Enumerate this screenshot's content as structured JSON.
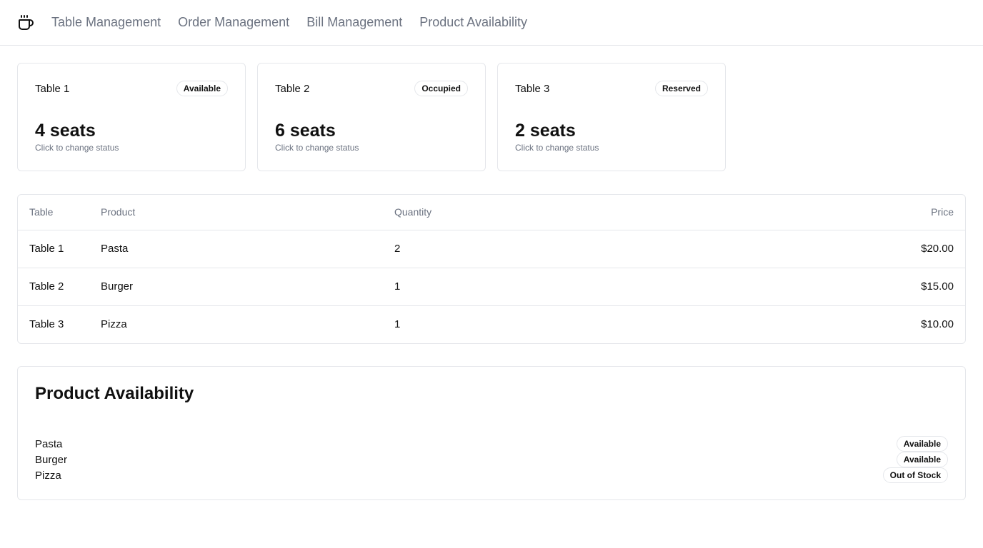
{
  "header": {
    "logo_icon": "coffee-cup-icon",
    "nav": [
      {
        "label": "Table Management"
      },
      {
        "label": "Order Management"
      },
      {
        "label": "Bill Management"
      },
      {
        "label": "Product Availability"
      }
    ]
  },
  "tables": [
    {
      "name": "Table 1",
      "status": "Available",
      "seats": "4 seats",
      "hint": "Click to change status"
    },
    {
      "name": "Table 2",
      "status": "Occupied",
      "seats": "6 seats",
      "hint": "Click to change status"
    },
    {
      "name": "Table 3",
      "status": "Reserved",
      "seats": "2 seats",
      "hint": "Click to change status"
    }
  ],
  "orders": {
    "headers": {
      "table": "Table",
      "product": "Product",
      "quantity": "Quantity",
      "price": "Price"
    },
    "rows": [
      {
        "table": "Table 1",
        "product": "Pasta",
        "quantity": "2",
        "price": "$20.00"
      },
      {
        "table": "Table 2",
        "product": "Burger",
        "quantity": "1",
        "price": "$15.00"
      },
      {
        "table": "Table 3",
        "product": "Pizza",
        "quantity": "1",
        "price": "$10.00"
      }
    ]
  },
  "availability": {
    "title": "Product Availability",
    "items": [
      {
        "name": "Pasta",
        "status": "Available"
      },
      {
        "name": "Burger",
        "status": "Available"
      },
      {
        "name": "Pizza",
        "status": "Out of Stock"
      }
    ]
  },
  "colors": {
    "border": "#e5e7eb",
    "muted_text": "#6b7280",
    "text": "#111111"
  }
}
